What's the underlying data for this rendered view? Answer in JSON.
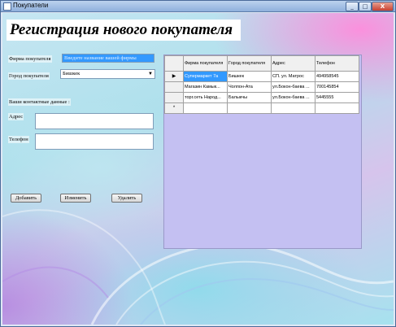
{
  "window": {
    "title": "Покупатели",
    "min_glyph": "_",
    "max_glyph": "□",
    "close_glyph": "X"
  },
  "form": {
    "heading": "Регистрация нового покупателя",
    "firm_label": "Фирма покупателя",
    "firm_value": "Введите название вашей фирмы",
    "city_label": "Город покупателя",
    "city_value": "Бишкек",
    "contacts_label": "Ваши контактные данные :",
    "address_label": "Адрес",
    "address_value": "",
    "phone_label": "Телефон",
    "phone_value": ""
  },
  "buttons": {
    "add": "Добавить",
    "edit": "Изменить",
    "delete": "Удалить"
  },
  "grid": {
    "columns": [
      "Фирма покупателя",
      "Город покупателя",
      "Адрес",
      "Телефон"
    ],
    "rows": [
      [
        "Супермаркет 7а",
        "Бишкек",
        "СП. ул. Матрос",
        "494958545"
      ],
      [
        "Магазин Камык...",
        "Чолпон-Ата",
        "ул.Бокон-баева ...",
        "700145854"
      ],
      [
        "торг.сеть Народ...",
        "Балыкчы",
        "ул.Бокон-баева ...",
        "5445555"
      ]
    ],
    "current_row_marker": "▶",
    "new_row_marker": "*"
  }
}
